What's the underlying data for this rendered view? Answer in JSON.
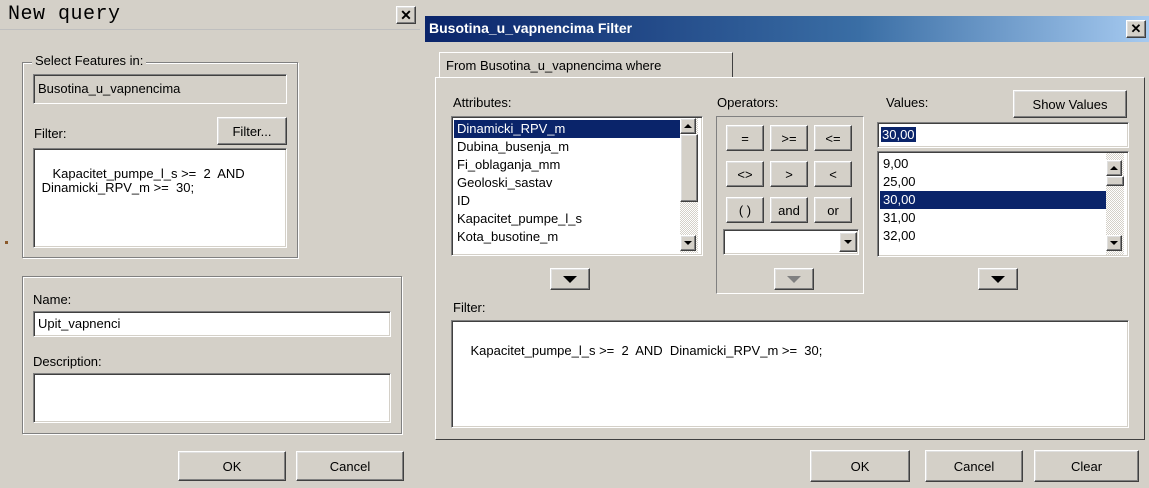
{
  "left": {
    "title": "New query",
    "close_glyph": "✕",
    "select_features_label": "Select Features in:",
    "layer_name": "Busotina_u_vapnencima",
    "filter_label": "Filter:",
    "filter_button": "Filter...",
    "filter_text": "Kapacitet_pumpe_l_s >=  2  AND\n Dinamicki_RPV_m >=  30;",
    "name_label": "Name:",
    "name_value": "Upit_vapnenci",
    "description_label": "Description:",
    "description_value": "",
    "ok": "OK",
    "cancel": "Cancel"
  },
  "right": {
    "title": "Busotina_u_vapnencima Filter",
    "close_glyph": "✕",
    "tab_label": "From Busotina_u_vapnencima where",
    "attributes_label": "Attributes:",
    "attributes": [
      "Dinamicki_RPV_m",
      "Dubina_busenja_m",
      "Fi_oblaganja_mm",
      "Geoloski_sastav",
      "ID",
      "Kapacitet_pumpe_l_s",
      "Kota_busotine_m"
    ],
    "attributes_selected_index": 0,
    "operators_label": "Operators:",
    "operators": [
      "=",
      ">=",
      "<=",
      "<>",
      ">",
      "<",
      "( )",
      "and",
      "or"
    ],
    "values_label": "Values:",
    "show_values_button": "Show Values",
    "values_input": "30,00",
    "values": [
      "9,00",
      "25,00",
      "30,00",
      "31,00",
      "32,00"
    ],
    "values_selected_index": 2,
    "filter_label": "Filter:",
    "filter_text": "Kapacitet_pumpe_l_s >=  2  AND  Dinamicki_RPV_m >=  30;",
    "ok": "OK",
    "cancel": "Cancel",
    "clear": "Clear"
  },
  "icons": {
    "close": "close-icon",
    "dropdown": "triangle-down-icon",
    "scroll_up": "scroll-up-icon",
    "scroll_down": "scroll-down-icon"
  },
  "colors": {
    "dialog_face": "#d4d0c8",
    "title_active": "#0a246a",
    "selection": "#0a246a"
  }
}
